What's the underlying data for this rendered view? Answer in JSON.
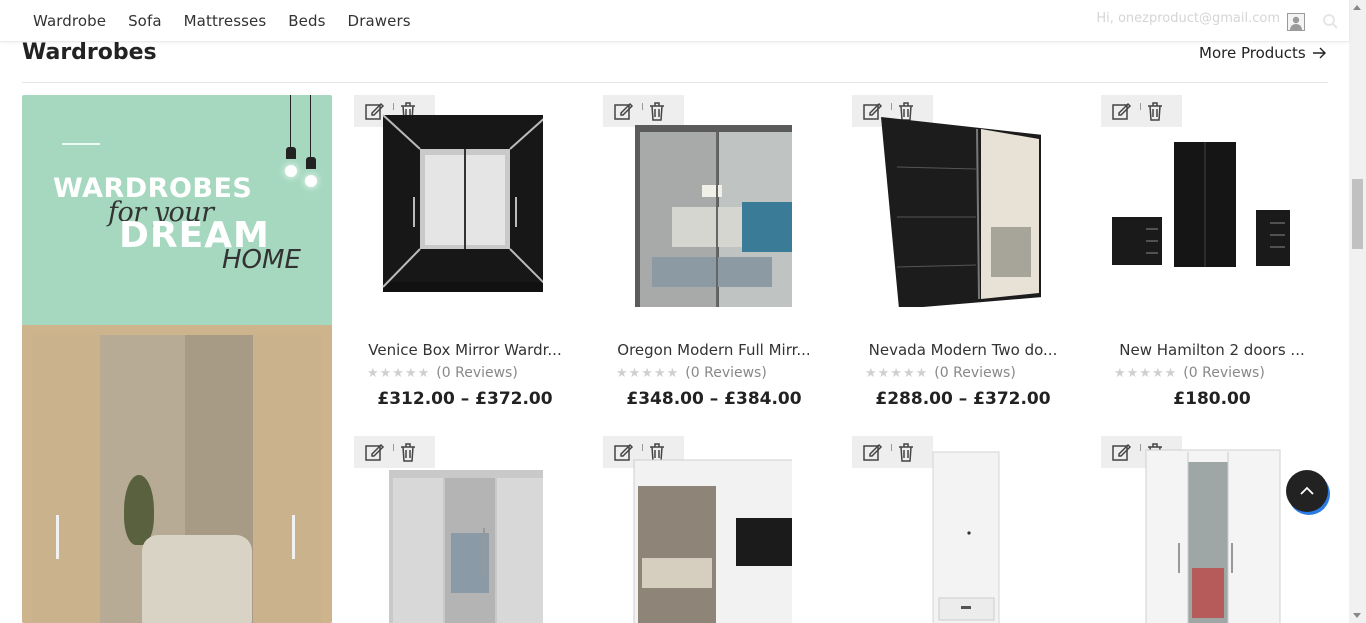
{
  "nav": {
    "items": [
      {
        "label": "Wardrobe"
      },
      {
        "label": "Sofa"
      },
      {
        "label": "Mattresses"
      },
      {
        "label": "Beds"
      },
      {
        "label": "Drawers"
      }
    ],
    "account_text": "Hi, onezproduct@gmail.com"
  },
  "section": {
    "title": "Wardrobes",
    "more_label": "More Products"
  },
  "banner": {
    "line1": "WARDROBES",
    "line2": "for your",
    "line3": "DREAM",
    "line4": "HOME"
  },
  "products": [
    {
      "name": "Venice Box Mirror Wardr...",
      "stars": "★★★★★",
      "reviews": "(0 Reviews)",
      "price": "£312.00 – £372.00",
      "image": "wardrobe-black-mirror"
    },
    {
      "name": "Oregon Modern Full Mirr...",
      "stars": "★★★★★",
      "reviews": "(0 Reviews)",
      "price": "£348.00 – £384.00",
      "image": "wardrobe-grey-full-mirror"
    },
    {
      "name": "Nevada Modern Two do...",
      "stars": "★★★★★",
      "reviews": "(0 Reviews)",
      "price": "£288.00 – £372.00",
      "image": "wardrobe-black-two-door"
    },
    {
      "name": "New Hamilton 2 doors ...",
      "stars": "★★★★★",
      "reviews": "(0 Reviews)",
      "price": "£180.00",
      "image": "wardrobe-set-black"
    },
    {
      "image": "wardrobe-grey-gloss"
    },
    {
      "image": "wardrobe-white-black-panel"
    },
    {
      "image": "wardrobe-white-single"
    },
    {
      "image": "wardrobe-white-three-door"
    }
  ],
  "colors": {
    "banner_bg": "#a5d8bf",
    "scroll_top_bg": "#222222",
    "scroll_top_shadow": "#2a7be4"
  }
}
